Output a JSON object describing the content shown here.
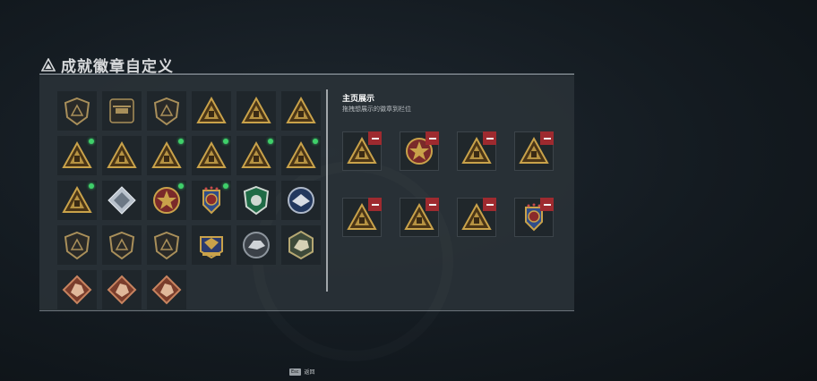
{
  "header": {
    "title": "成就徽章自定义"
  },
  "showcase": {
    "title": "主页展示",
    "subtitle": "拖拽想展示的徽章到栏位"
  },
  "footer": {
    "esc_key": "Esc",
    "back_label": "返回"
  },
  "colors": {
    "gold": "#c9a24a",
    "red": "#9e2a2f",
    "new_dot": "#3fd06a"
  },
  "badges": [
    {
      "icon": "shield-triangle-icon",
      "type": "shield",
      "new": false
    },
    {
      "icon": "helicopter-icon",
      "type": "square",
      "new": false
    },
    {
      "icon": "shield-diamond-icon",
      "type": "shield",
      "new": false
    },
    {
      "icon": "backpack-triangle-icon",
      "type": "triangle",
      "new": false
    },
    {
      "icon": "sg-triangle-icon",
      "type": "triangle",
      "new": false
    },
    {
      "icon": "backpack-triangle-icon",
      "type": "triangle",
      "new": false
    },
    {
      "icon": "ammo-triangle-icon",
      "type": "triangle",
      "new": true
    },
    {
      "icon": "drone-triangle-icon",
      "type": "triangle",
      "new": false
    },
    {
      "icon": "boat-triangle-icon",
      "type": "triangle",
      "new": true
    },
    {
      "icon": "number-one-triangle-icon",
      "type": "triangle",
      "new": true
    },
    {
      "icon": "crate-triangle-icon",
      "type": "triangle",
      "new": true
    },
    {
      "icon": "soldier-triangle-icon",
      "type": "triangle",
      "new": true
    },
    {
      "icon": "tower-triangle-icon",
      "type": "triangle",
      "new": true
    },
    {
      "icon": "diamond-gem-icon",
      "type": "diamond",
      "new": false
    },
    {
      "icon": "star-medal-icon",
      "type": "round",
      "new": true
    },
    {
      "icon": "winged-medal-icon",
      "type": "medal",
      "new": true
    },
    {
      "icon": "green-shield-icon",
      "type": "green",
      "new": false
    },
    {
      "icon": "blue-eagle-icon",
      "type": "blue",
      "new": false
    },
    {
      "icon": "rifle-shield-icon",
      "type": "shield",
      "new": false
    },
    {
      "icon": "rifle-shield-icon",
      "type": "shield",
      "new": false
    },
    {
      "icon": "bird-shield-icon",
      "type": "shield",
      "new": false
    },
    {
      "icon": "eagle-crest-icon",
      "type": "crest",
      "new": false
    },
    {
      "icon": "wolf-round-icon",
      "type": "round-dark",
      "new": false
    },
    {
      "icon": "wolf-hex-icon",
      "type": "hex",
      "new": false
    },
    {
      "icon": "beast-copper-icon",
      "type": "copper",
      "new": false
    },
    {
      "icon": "beast-copper-icon",
      "type": "copper",
      "new": false
    },
    {
      "icon": "soldier-copper-icon",
      "type": "copper",
      "new": false
    }
  ],
  "slots": [
    {
      "icon": "crate-triangle-icon",
      "type": "triangle"
    },
    {
      "icon": "star-medal-icon",
      "type": "round"
    },
    {
      "icon": "boat-triangle-icon",
      "type": "triangle"
    },
    {
      "icon": "number-one-triangle-icon",
      "type": "triangle"
    },
    {
      "icon": "soldier-triangle-icon",
      "type": "triangle"
    },
    {
      "icon": "tower-triangle-icon",
      "type": "triangle"
    },
    {
      "icon": "ammo-triangle-icon",
      "type": "triangle"
    },
    {
      "icon": "winged-medal-icon",
      "type": "medal"
    }
  ]
}
